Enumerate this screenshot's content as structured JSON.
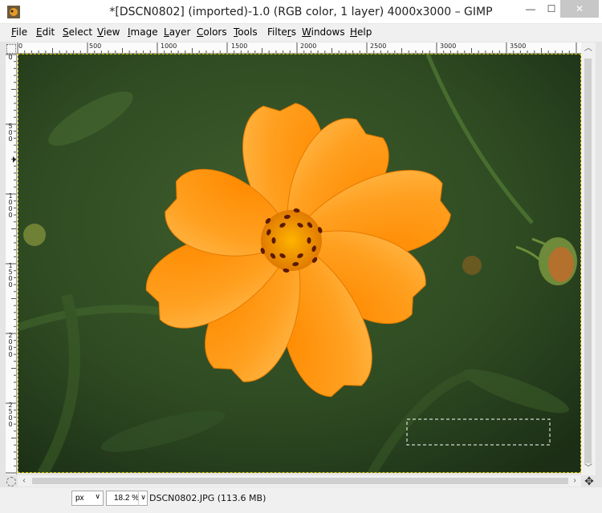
{
  "window": {
    "title": "*[DSCN0802] (imported)-1.0 (RGB color, 1 layer) 4000x3000 – GIMP",
    "minimize_glyph": "—",
    "maximize_glyph": "☐",
    "close_glyph": "✕",
    "app_icon": "gimp-icon"
  },
  "menubar": {
    "items": [
      {
        "label": "File",
        "mnemonic": "F"
      },
      {
        "label": "Edit",
        "mnemonic": "E"
      },
      {
        "label": "Select",
        "mnemonic": "S"
      },
      {
        "label": "View",
        "mnemonic": "V"
      },
      {
        "label": "Image",
        "mnemonic": "I"
      },
      {
        "label": "Layer",
        "mnemonic": "L"
      },
      {
        "label": "Colors",
        "mnemonic": "C"
      },
      {
        "label": "Tools",
        "mnemonic": "T"
      },
      {
        "label": "Filters",
        "mnemonic": "r"
      },
      {
        "label": "Windows",
        "mnemonic": "W"
      },
      {
        "label": "Help",
        "mnemonic": "H"
      }
    ]
  },
  "rulers": {
    "horizontal": [
      "0",
      "500",
      "1000",
      "1500",
      "2000",
      "2500",
      "3000",
      "3500"
    ],
    "vertical": [
      "0",
      "500",
      "1000",
      "1500",
      "2000",
      "2500"
    ]
  },
  "canvas": {
    "image_description_colors": {
      "background": "#2f4b23",
      "petal": "#ff9a12",
      "petal_shade": "#f07d00",
      "center": "#e58a00",
      "selection": "#ffffff"
    }
  },
  "statusbar": {
    "unit": "px",
    "zoom": "18.2 %",
    "file_info": "DSCN0802.JPG (113.6 MB)"
  }
}
